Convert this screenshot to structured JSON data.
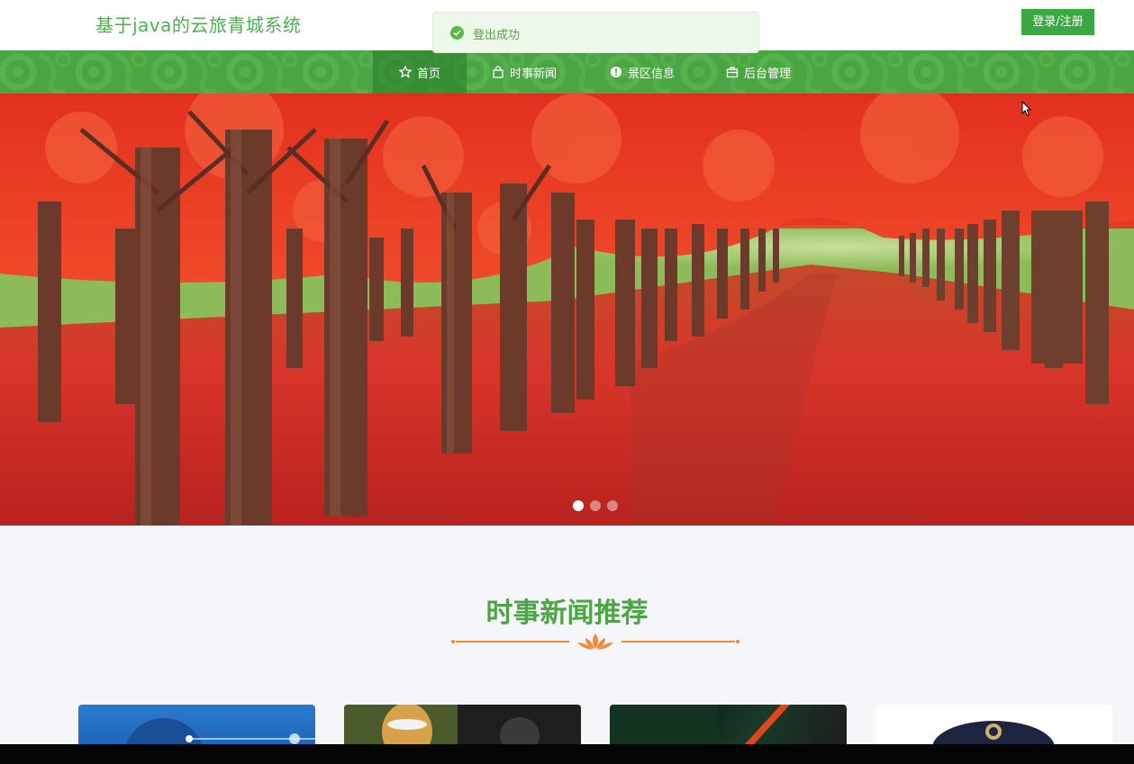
{
  "header": {
    "site_title": "基于java的云旅青城系统",
    "login_label": "登录/注册"
  },
  "toast": {
    "message": "登出成功"
  },
  "nav": {
    "items": [
      {
        "label": "首页",
        "icon": "star-icon"
      },
      {
        "label": "时事新闻",
        "icon": "bag-icon"
      },
      {
        "label": "景区信息",
        "icon": "info-icon"
      },
      {
        "label": "后台管理",
        "icon": "briefcase-icon"
      }
    ],
    "active_index": 0
  },
  "carousel": {
    "slide_count": 3,
    "active_index": 0
  },
  "news_section": {
    "title": "时事新闻推荐"
  },
  "colors": {
    "brand_green": "#4aa643",
    "button_green": "#3aa843",
    "divider_orange": "#ee8a3c"
  }
}
